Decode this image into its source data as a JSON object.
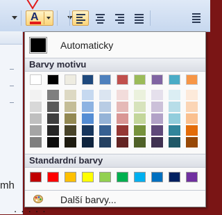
{
  "ribbon": {
    "font_color_glyph": "A",
    "font_color_current": "#e21b1b"
  },
  "popup": {
    "automatic_label": "Automaticky",
    "automatic_color": "#000000",
    "theme_header": "Barvy motivu",
    "theme_colors": [
      "#ffffff",
      "#000000",
      "#eeece1",
      "#1f497d",
      "#4f81bd",
      "#c0504d",
      "#9bbb59",
      "#8064a2",
      "#4bacc6",
      "#f79646"
    ],
    "theme_shades": [
      [
        "#f2f2f2",
        "#d8d8d8",
        "#bfbfbf",
        "#a5a5a5",
        "#7f7f7f"
      ],
      [
        "#7f7f7f",
        "#595959",
        "#3f3f3f",
        "#262626",
        "#0c0c0c"
      ],
      [
        "#ddd9c3",
        "#c4bd97",
        "#938953",
        "#494429",
        "#1d1b10"
      ],
      [
        "#c6d9f0",
        "#8db3e2",
        "#548dd4",
        "#17365d",
        "#0f243e"
      ],
      [
        "#dbe5f1",
        "#b8cce4",
        "#95b3d7",
        "#366092",
        "#244061"
      ],
      [
        "#f2dcdb",
        "#e5b9b7",
        "#d99694",
        "#953734",
        "#632423"
      ],
      [
        "#ebf1dd",
        "#d7e3bc",
        "#c3d69b",
        "#76923c",
        "#4f6128"
      ],
      [
        "#e5e0ec",
        "#ccc1d9",
        "#b2a2c7",
        "#5f497a",
        "#3f3151"
      ],
      [
        "#dbeef3",
        "#b7dde8",
        "#92cddc",
        "#31859b",
        "#205867"
      ],
      [
        "#fdeada",
        "#fbd5b5",
        "#fac08f",
        "#e36c09",
        "#974806"
      ]
    ],
    "standard_header": "Standardní barvy",
    "standard_colors": [
      "#c00000",
      "#ff0000",
      "#ffc000",
      "#ffff00",
      "#92d050",
      "#00b050",
      "#00b0f0",
      "#0070c0",
      "#002060",
      "#7030a0"
    ],
    "more_colors_label": "Další barvy...",
    "more_colors_icon": "palette-icon"
  },
  "document": {
    "visible_text_fragment": "mh",
    "bottom_text_fragment": ". . . . ."
  }
}
